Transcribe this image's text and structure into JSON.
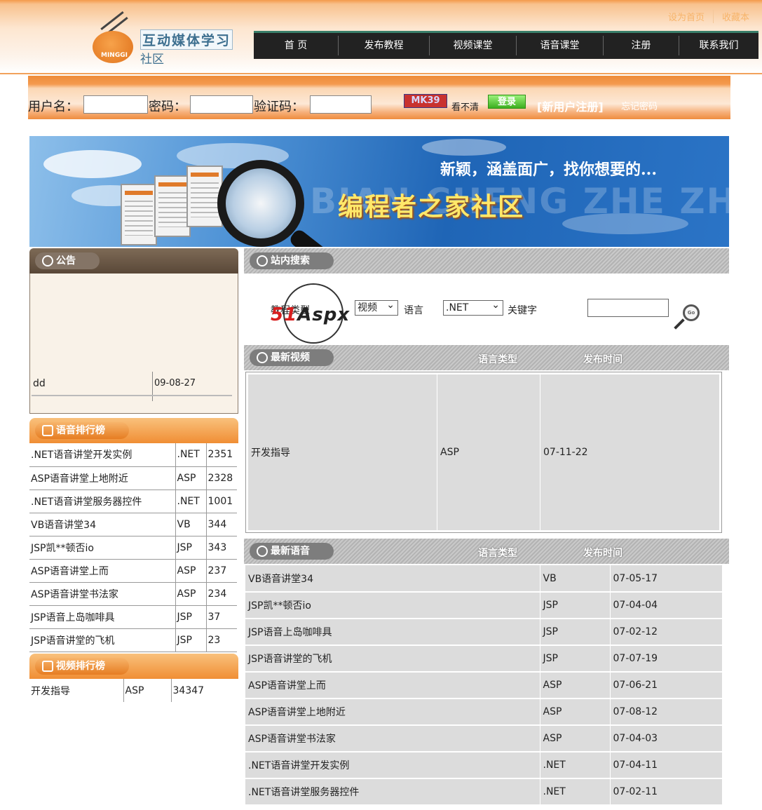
{
  "header": {
    "top_links": [
      "设为首页",
      "收藏本"
    ],
    "logo_title": "互动媒体学习",
    "logo_sub": "社区",
    "nav": [
      "首 页",
      "发布教程",
      "视频课堂",
      "语音课堂",
      "注册",
      "联系我们"
    ]
  },
  "login": {
    "username_label": "用户名：",
    "password_label": "密码：",
    "captcha_label": "验证码：",
    "captcha_code": "MK39",
    "refresh_text": "看不清",
    "login_button": "登录",
    "register_link": "[新用户注册]",
    "forgot_link": "忘记密码"
  },
  "banner": {
    "slogan": "新颖，涵盖面广，找你想要的...",
    "title": "编程者之家社区",
    "ghost": "BIAN CHENG ZHE ZHI JIA"
  },
  "notice": {
    "title": "公告",
    "items": [
      {
        "title": "dd",
        "date": "09-08-27"
      }
    ]
  },
  "voice_rank": {
    "title": "语音排行榜",
    "rows": [
      [
        ".NET语音讲堂开发实例",
        ".NET",
        "2351"
      ],
      [
        "ASP语音讲堂上地附近",
        "ASP",
        "2328"
      ],
      [
        ".NET语音讲堂服务器控件",
        ".NET",
        "1001"
      ],
      [
        "VB语音讲堂34",
        "VB",
        "344"
      ],
      [
        "JSP凯**顿否io",
        "JSP",
        "343"
      ],
      [
        "ASP语音讲堂上而",
        "ASP",
        "237"
      ],
      [
        "ASP语音讲堂书法家",
        "ASP",
        "234"
      ],
      [
        "JSP语音上岛咖啡具",
        "JSP",
        "37"
      ],
      [
        "JSP语音讲堂的飞机",
        "JSP",
        "23"
      ]
    ]
  },
  "video_rank": {
    "title": "视频排行榜",
    "rows": [
      [
        "开发指导",
        "ASP",
        "34347"
      ]
    ]
  },
  "search": {
    "title": "站内搜索",
    "type_label": "教程类型",
    "type_value": "视频",
    "lang_label": "语言",
    "lang_value": ".NET",
    "keyword_label": "关键字",
    "go_text": "Go"
  },
  "watermark": {
    "logo_51": "51",
    "logo_aspx": "Aspx"
  },
  "latest_video": {
    "title": "最新视频",
    "col_lang": "语言类型",
    "col_date": "发布时间",
    "rows": [
      [
        "开发指导",
        "ASP",
        "07-11-22"
      ]
    ]
  },
  "latest_voice": {
    "title": "最新语音",
    "col_lang": "语言类型",
    "col_date": "发布时间",
    "rows": [
      [
        "VB语音讲堂34",
        "VB",
        "07-05-17"
      ],
      [
        "JSP凯**顿否io",
        "JSP",
        "07-04-04"
      ],
      [
        "JSP语音上岛咖啡具",
        "JSP",
        "07-02-12"
      ],
      [
        "JSP语音讲堂的飞机",
        "JSP",
        "07-07-19"
      ],
      [
        "ASP语音讲堂上而",
        "ASP",
        "07-06-21"
      ],
      [
        "ASP语音讲堂上地附近",
        "ASP",
        "07-08-12"
      ],
      [
        "ASP语音讲堂书法家",
        "ASP",
        "07-04-03"
      ],
      [
        ".NET语音讲堂开发实例",
        ".NET",
        "07-04-11"
      ],
      [
        ".NET语音讲堂服务器控件",
        ".NET",
        "07-02-11"
      ]
    ]
  }
}
